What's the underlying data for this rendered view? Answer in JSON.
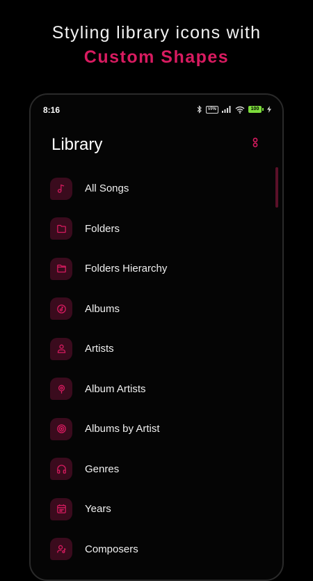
{
  "promo": {
    "line1": "Styling library icons with",
    "line2": "Custom Shapes"
  },
  "status_bar": {
    "time": "8:16",
    "vpn": "VPN",
    "battery": "100"
  },
  "header": {
    "title": "Library"
  },
  "library_items": [
    {
      "label": "All Songs",
      "icon": "music-note-icon"
    },
    {
      "label": "Folders",
      "icon": "folder-icon"
    },
    {
      "label": "Folders Hierarchy",
      "icon": "folder-hierarchy-icon"
    },
    {
      "label": "Albums",
      "icon": "album-icon"
    },
    {
      "label": "Artists",
      "icon": "person-icon"
    },
    {
      "label": "Album Artists",
      "icon": "microphone-icon"
    },
    {
      "label": "Albums by Artist",
      "icon": "disc-icon"
    },
    {
      "label": "Genres",
      "icon": "headphones-icon"
    },
    {
      "label": "Years",
      "icon": "calendar-icon"
    },
    {
      "label": "Composers",
      "icon": "composers-icon"
    }
  ],
  "colors": {
    "accent": "#d81b60",
    "icon_bg": "#3a0b1d",
    "background": "#000000"
  }
}
